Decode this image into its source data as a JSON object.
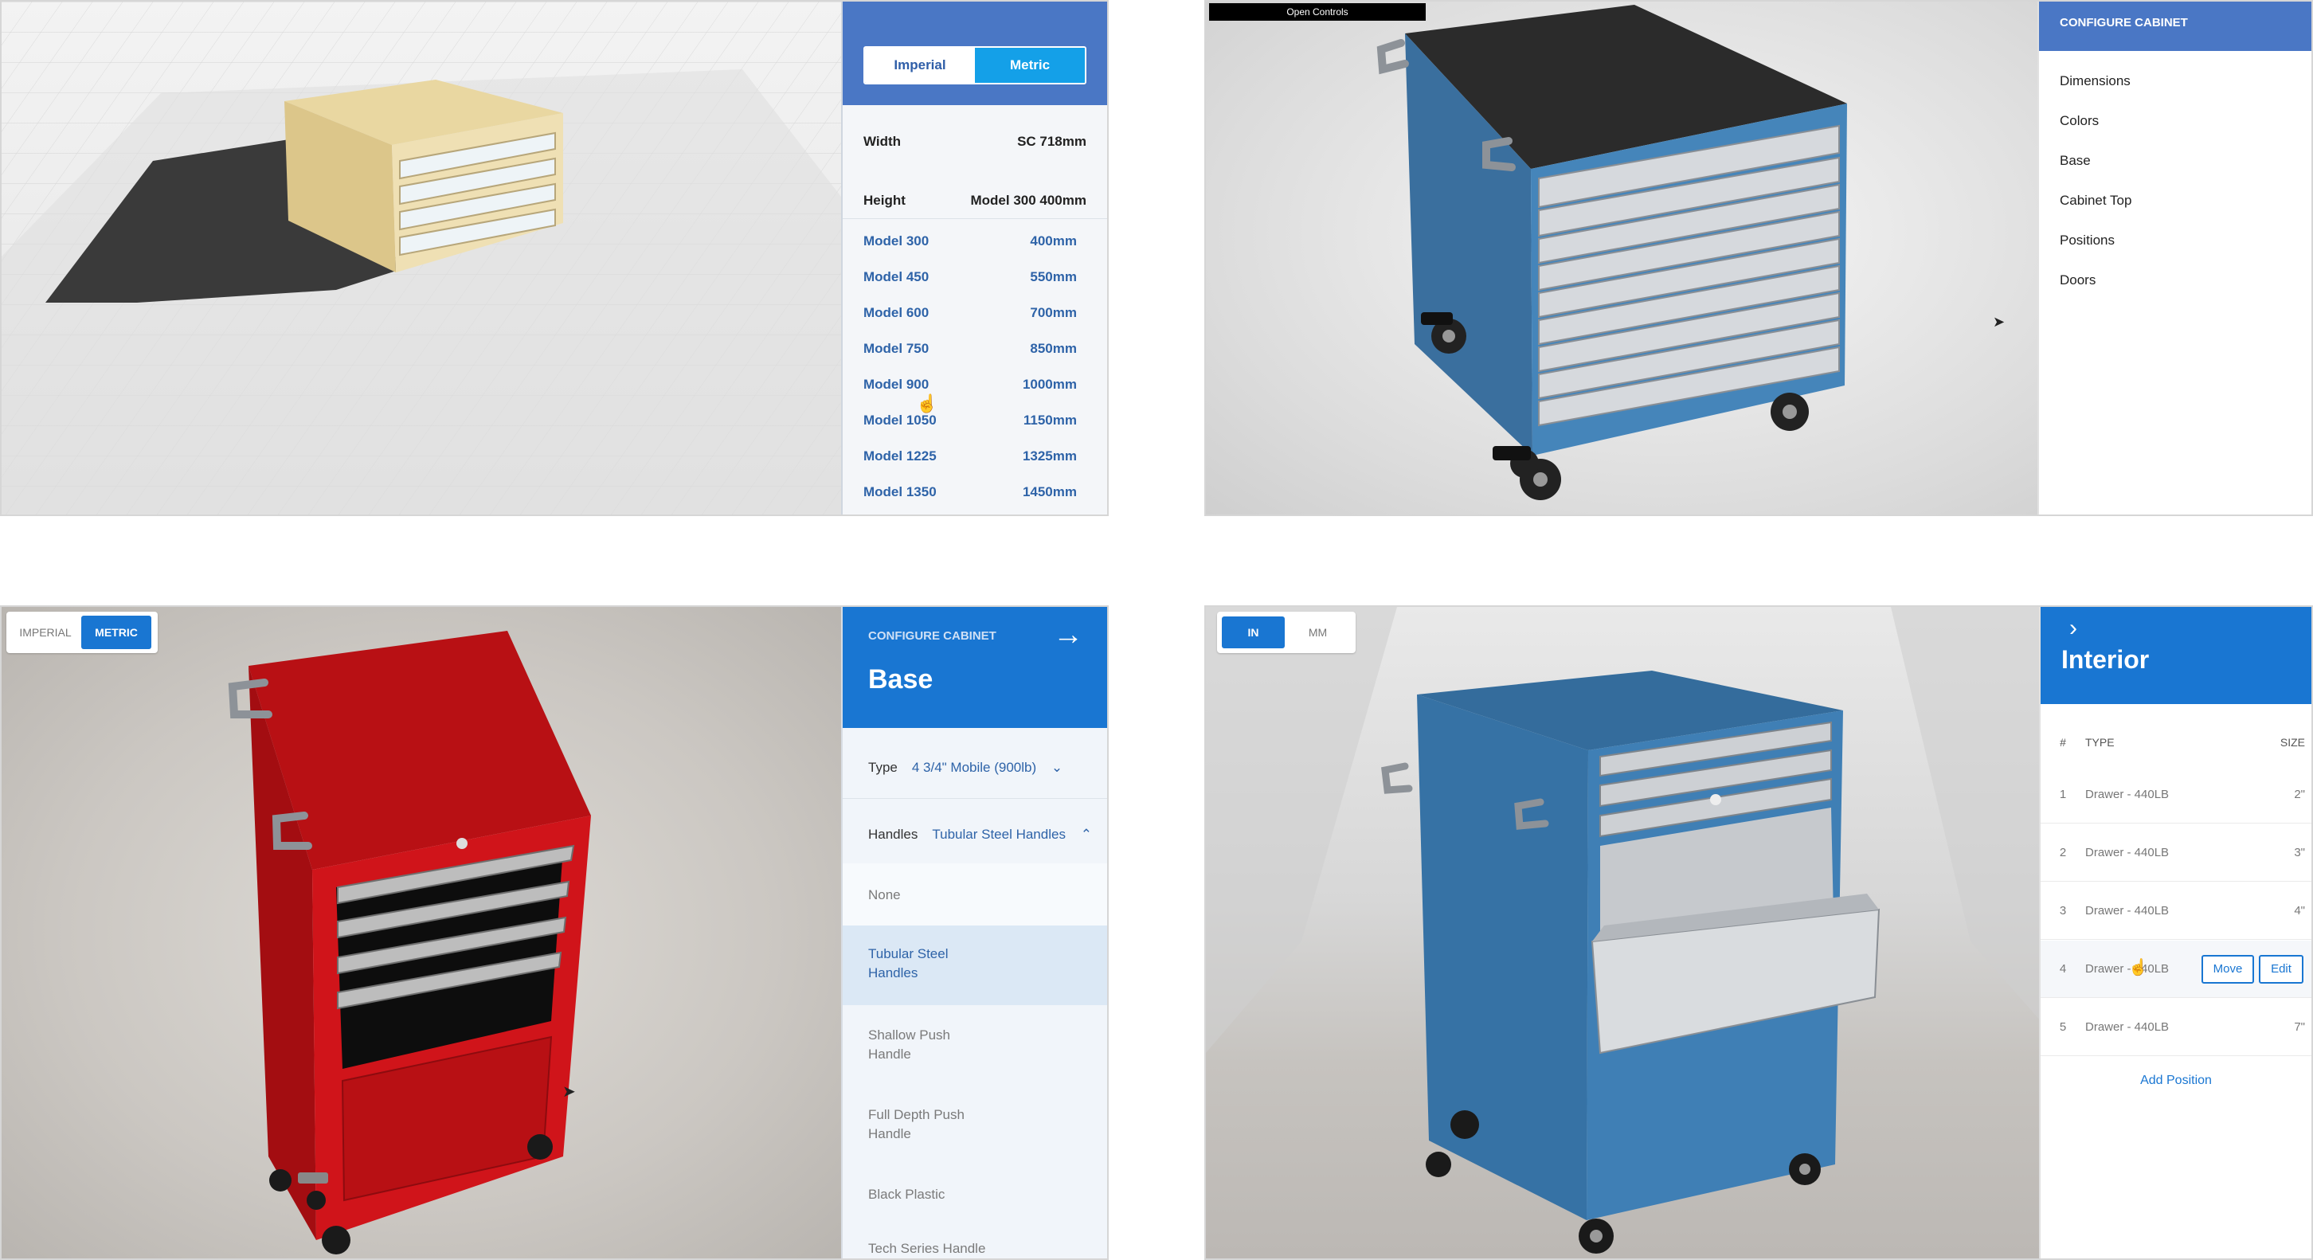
{
  "panel1": {
    "units": {
      "imperial": "Imperial",
      "metric": "Metric"
    },
    "width": {
      "label": "Width",
      "value": "SC  718mm"
    },
    "height": {
      "label": "Height",
      "value": "Model 300  400mm"
    },
    "models": [
      {
        "name": "Model 300",
        "size": "400mm"
      },
      {
        "name": "Model 450",
        "size": "550mm"
      },
      {
        "name": "Model 600",
        "size": "700mm"
      },
      {
        "name": "Model 750",
        "size": "850mm"
      },
      {
        "name": "Model 900",
        "size": "1000mm"
      },
      {
        "name": "Model 1050",
        "size": "1150mm"
      },
      {
        "name": "Model 1225",
        "size": "1325mm"
      },
      {
        "name": "Model 1350",
        "size": "1450mm"
      }
    ]
  },
  "panel2": {
    "open_controls": "Open Controls",
    "header": "CONFIGURE CABINET",
    "menu": [
      "Dimensions",
      "Colors",
      "Base",
      "Cabinet Top",
      "Positions",
      "Doors"
    ]
  },
  "panel3": {
    "units": {
      "imperial": "IMPERIAL",
      "metric": "METRIC"
    },
    "header": {
      "kicker": "CONFIGURE CABINET",
      "title": "Base"
    },
    "type": {
      "label": "Type",
      "value": "4 3/4\" Mobile (900lb)"
    },
    "handles": {
      "label": "Handles",
      "value": "Tubular Steel Handles"
    },
    "options": [
      {
        "line1": "None",
        "line2": ""
      },
      {
        "line1": "Tubular Steel",
        "line2": "Handles"
      },
      {
        "line1": "Shallow Push",
        "line2": "Handle"
      },
      {
        "line1": "Full Depth Push",
        "line2": "Handle"
      },
      {
        "line1": "Black Plastic",
        "line2": ""
      },
      {
        "line1": "Tech Series Handle",
        "line2": ""
      }
    ]
  },
  "panel4": {
    "units": {
      "in": "IN",
      "mm": "MM"
    },
    "title": "Interior",
    "columns": {
      "num": "#",
      "type": "TYPE",
      "size": "SIZE"
    },
    "rows": [
      {
        "num": "1",
        "type": "Drawer - 440LB",
        "size": "2\""
      },
      {
        "num": "2",
        "type": "Drawer - 440LB",
        "size": "3\""
      },
      {
        "num": "3",
        "type": "Drawer - 440LB",
        "size": "4\""
      },
      {
        "num": "4",
        "type": "Drawer - 440LB",
        "size": ""
      },
      {
        "num": "5",
        "type": "Drawer - 440LB",
        "size": "7\""
      }
    ],
    "row_actions": {
      "move": "Move",
      "edit": "Edit"
    },
    "add_position": "Add Position"
  },
  "colors": {
    "blue_header": "#4a77c5",
    "primary_blue": "#1976d2",
    "metric_active": "#14a0e8",
    "cabinet_blue": "#3f7fb5",
    "cabinet_red": "#d0141a",
    "cabinet_tan": "#e6d39a"
  }
}
